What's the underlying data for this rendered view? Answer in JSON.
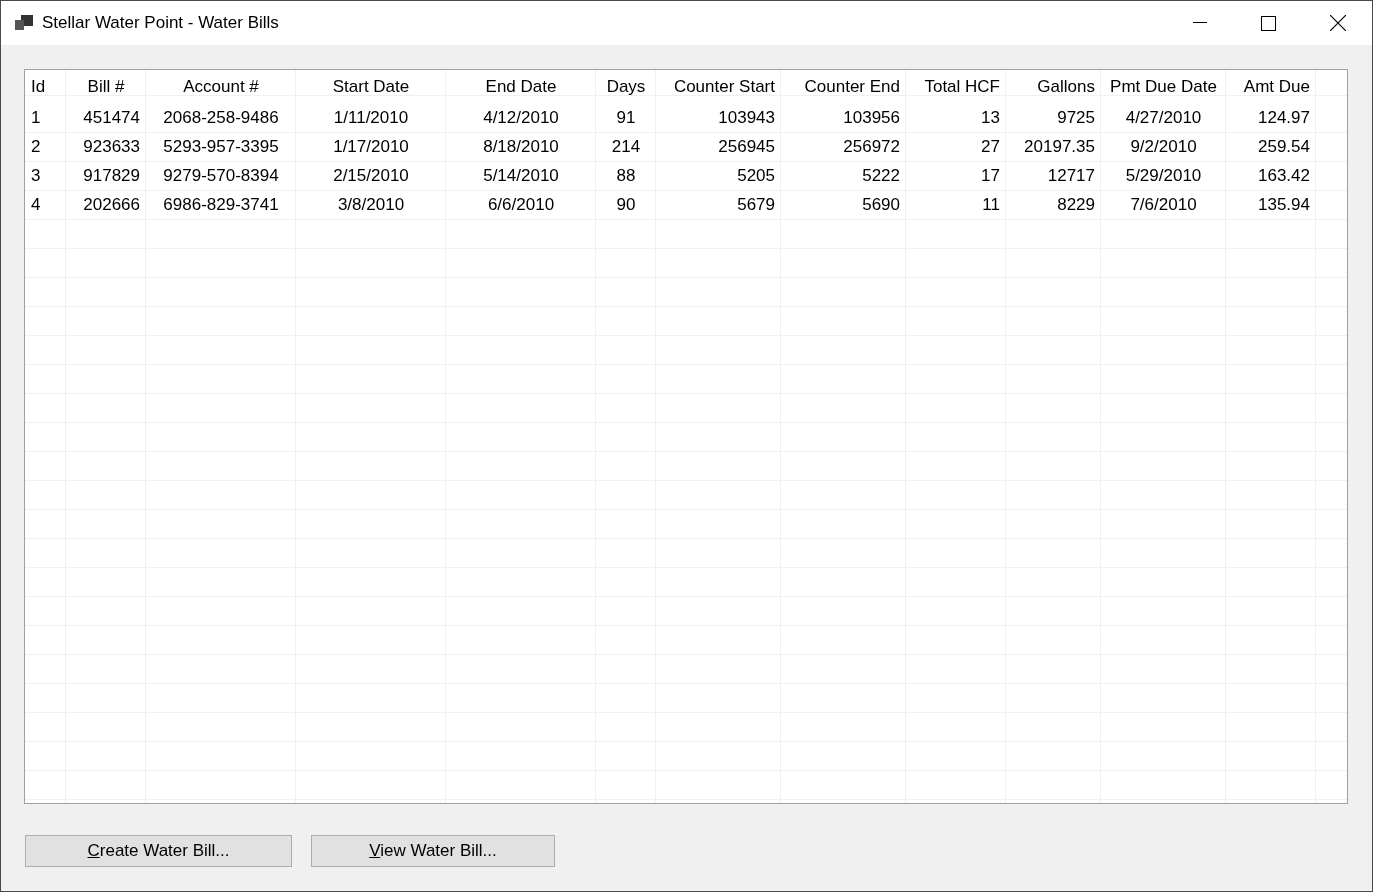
{
  "window": {
    "title": "Stellar Water Point - Water Bills"
  },
  "table": {
    "columns": [
      "Id",
      "Bill #",
      "Account #",
      "Start Date",
      "End Date",
      "Days",
      "Counter Start",
      "Counter End",
      "Total HCF",
      "Gallons",
      "Pmt Due Date",
      "Amt Due"
    ],
    "rows": [
      [
        "1",
        "451474",
        "2068-258-9486",
        "1/11/2010",
        "4/12/2010",
        "91",
        "103943",
        "103956",
        "13",
        "9725",
        "4/27/2010",
        "124.97"
      ],
      [
        "2",
        "923633",
        "5293-957-3395",
        "1/17/2010",
        "8/18/2010",
        "214",
        "256945",
        "256972",
        "27",
        "20197.35",
        "9/2/2010",
        "259.54"
      ],
      [
        "3",
        "917829",
        "9279-570-8394",
        "2/15/2010",
        "5/14/2010",
        "88",
        "5205",
        "5222",
        "17",
        "12717",
        "5/29/2010",
        "163.42"
      ],
      [
        "4",
        "202666",
        "6986-829-3741",
        "3/8/2010",
        "6/6/2010",
        "90",
        "5679",
        "5690",
        "11",
        "8229",
        "7/6/2010",
        "135.94"
      ]
    ]
  },
  "buttons": [
    {
      "label": "Create Water Bill...",
      "underline_first": true
    },
    {
      "label": "View Water Bill...",
      "underline_first": true
    }
  ]
}
